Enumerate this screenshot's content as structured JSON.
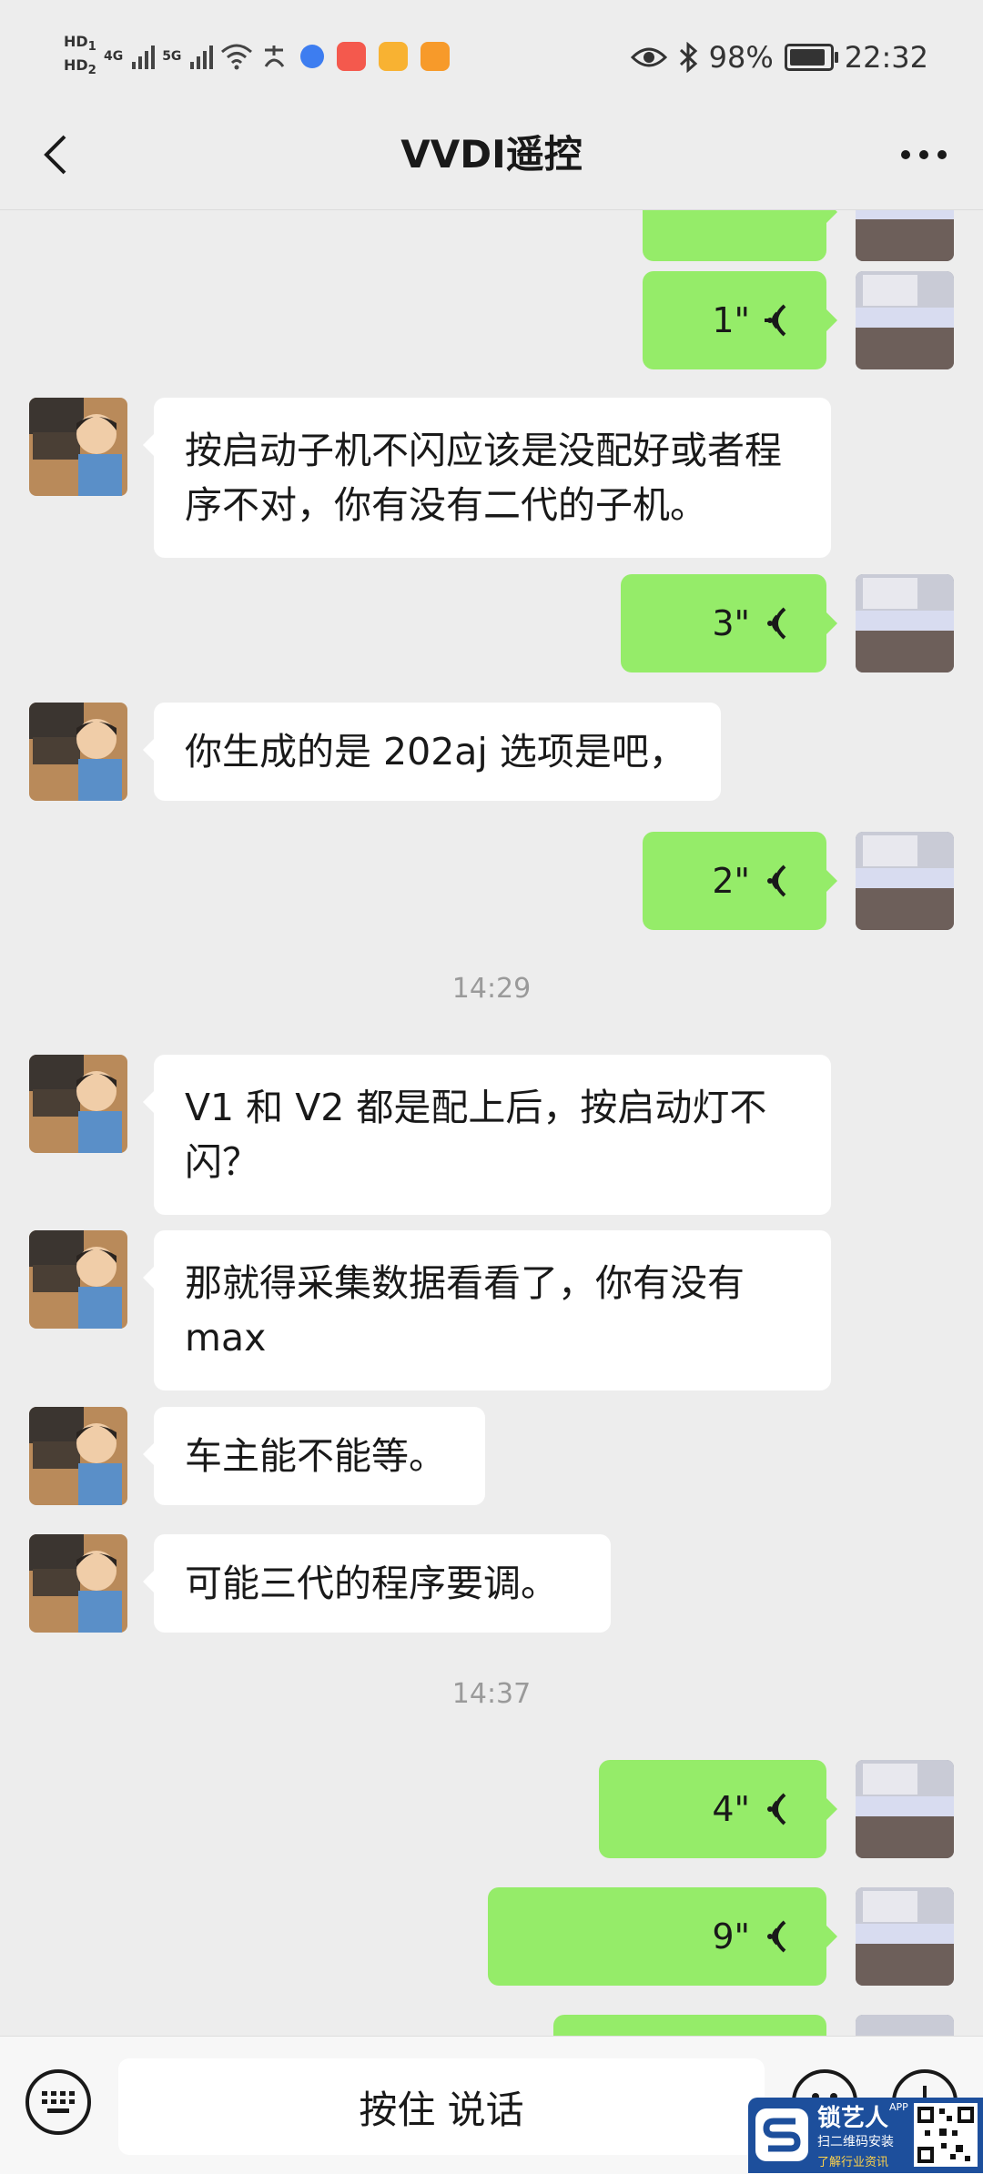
{
  "status_bar": {
    "hd1": "HD",
    "hd1_sub": "1",
    "hd2": "HD",
    "hd2_sub": "2",
    "net1": "4G",
    "net2": "5G",
    "battery": "98%",
    "time": "22:32"
  },
  "nav": {
    "title": "VVDI遥控"
  },
  "messages": [
    {
      "dir": "out",
      "type": "voice",
      "duration": "1\""
    },
    {
      "dir": "in",
      "type": "text",
      "text": "按启动子机不闪应该是没配好或者程序不对，你有没有二代的子机。"
    },
    {
      "dir": "out",
      "type": "voice",
      "duration": "3\""
    },
    {
      "dir": "in",
      "type": "text",
      "text": "你生成的是 202aj 选项是吧，"
    },
    {
      "dir": "out",
      "type": "voice",
      "duration": "2\""
    },
    {
      "dir": "in",
      "type": "text",
      "text": "V1 和 V2 都是配上后，按启动灯不闪？"
    },
    {
      "dir": "in",
      "type": "text",
      "text": "那就得采集数据看看了，你有没有 max"
    },
    {
      "dir": "in",
      "type": "text",
      "text": "车主能不能等。"
    },
    {
      "dir": "in",
      "type": "text",
      "text": "可能三代的程序要调。"
    },
    {
      "dir": "out",
      "type": "voice",
      "duration": "4\""
    },
    {
      "dir": "out",
      "type": "voice",
      "duration": "9\""
    }
  ],
  "time_separators": [
    "14:29",
    "14:37"
  ],
  "input_bar": {
    "hold_to_talk": "按住 说话"
  },
  "watermark": {
    "brand": "锁艺人",
    "app": "APP",
    "line1": "扫二维码安装",
    "line2": "了解行业资讯"
  },
  "colors": {
    "background": "#ededed",
    "outgoing_bubble": "#95ec69",
    "incoming_bubble": "#ffffff"
  }
}
